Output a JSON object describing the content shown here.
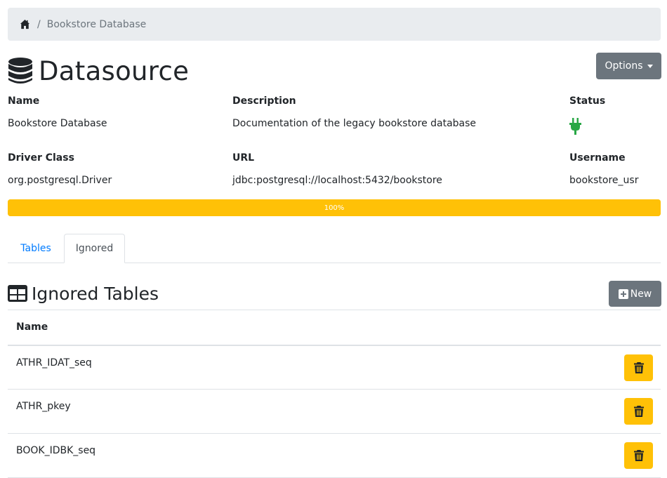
{
  "breadcrumb": {
    "home_icon": "home-icon",
    "current": "Bookstore Database"
  },
  "page": {
    "title": "Datasource",
    "title_icon": "database-icon"
  },
  "options_button": {
    "label": "Options"
  },
  "fields": {
    "name": {
      "label": "Name",
      "value": "Bookstore Database"
    },
    "description": {
      "label": "Description",
      "value": "Documentation of the legacy bookstore database"
    },
    "status": {
      "label": "Status",
      "icon": "plug-icon",
      "color": "#28a745"
    },
    "driver_class": {
      "label": "Driver Class",
      "value": "org.postgresql.Driver"
    },
    "url": {
      "label": "URL",
      "value": "jdbc:postgresql://localhost:5432/bookstore"
    },
    "username": {
      "label": "Username",
      "value": "bookstore_usr"
    }
  },
  "progress": {
    "value": 1.0,
    "label": "100%",
    "color": "#ffc107"
  },
  "tabs": [
    {
      "label": "Tables",
      "active": false
    },
    {
      "label": "Ignored",
      "active": true
    }
  ],
  "section": {
    "title": "Ignored Tables",
    "icon": "table-icon"
  },
  "new_button": {
    "label": "New",
    "icon": "plus-square-icon"
  },
  "table": {
    "header": "Name",
    "rows": [
      {
        "name": "ATHR_IDAT_seq",
        "action_icon": "trash-icon"
      },
      {
        "name": "ATHR_pkey",
        "action_icon": "trash-icon"
      },
      {
        "name": "BOOK_IDBK_seq",
        "action_icon": "trash-icon"
      }
    ]
  },
  "colors": {
    "accent": "#007bff",
    "secondary": "#6c757d",
    "warning": "#ffc107",
    "success": "#28a745"
  }
}
